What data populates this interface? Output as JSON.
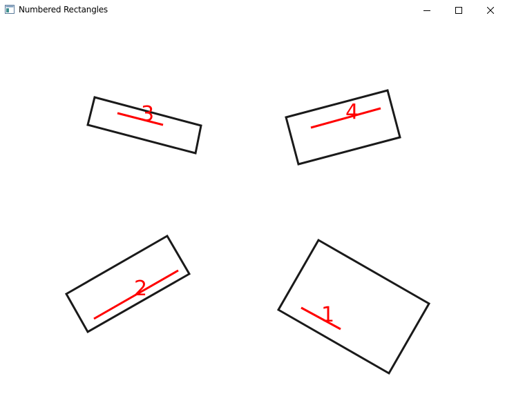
{
  "window": {
    "title": "Numbered Rectangles",
    "icon": "app-window-icon",
    "controls": {
      "minimize": "minimize-icon",
      "maximize": "maximize-icon",
      "close": "close-icon"
    }
  },
  "colors": {
    "rectangle_stroke": "#1a1a1a",
    "axis_line": "#ff0000",
    "label": "#ff0000",
    "background": "#ffffff"
  },
  "rectangles": [
    {
      "label": "1"
    },
    {
      "label": "2"
    },
    {
      "label": "3"
    },
    {
      "label": "4"
    }
  ]
}
